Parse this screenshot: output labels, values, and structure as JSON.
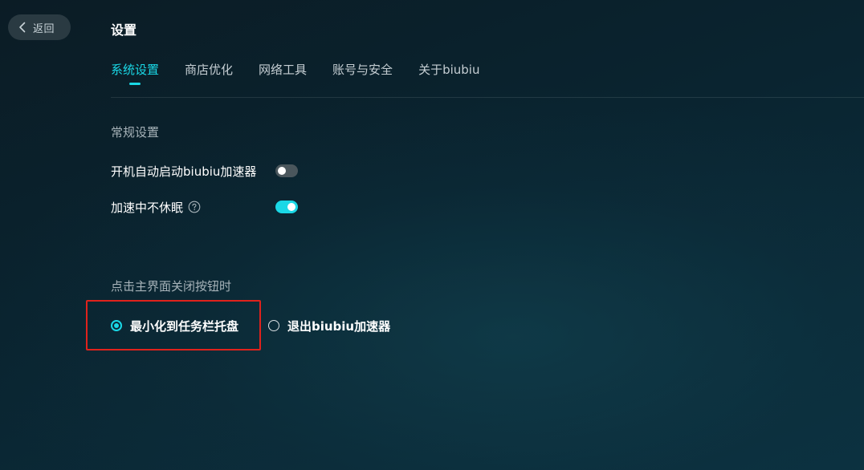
{
  "back": {
    "label": "返回"
  },
  "page_title": "设置",
  "tabs": [
    {
      "label": "系统设置",
      "active": true
    },
    {
      "label": "商店优化",
      "active": false
    },
    {
      "label": "网络工具",
      "active": false
    },
    {
      "label": "账号与安全",
      "active": false
    },
    {
      "label": "关于biubiu",
      "active": false
    }
  ],
  "general": {
    "title": "常规设置",
    "autostart": {
      "label": "开机自动启动biubiu加速器",
      "enabled": false
    },
    "no_sleep": {
      "label": "加速中不休眠",
      "enabled": true,
      "help_icon": "question-circle-icon"
    }
  },
  "close_behavior": {
    "title": "点击主界面关闭按钮时",
    "options": [
      {
        "label": "最小化到任务栏托盘",
        "selected": true
      },
      {
        "label": "退出biubiu加速器",
        "selected": false
      }
    ]
  },
  "colors": {
    "accent": "#1ad8e6",
    "highlight_box": "#e0221c",
    "toggle_off": "#4a565c"
  }
}
